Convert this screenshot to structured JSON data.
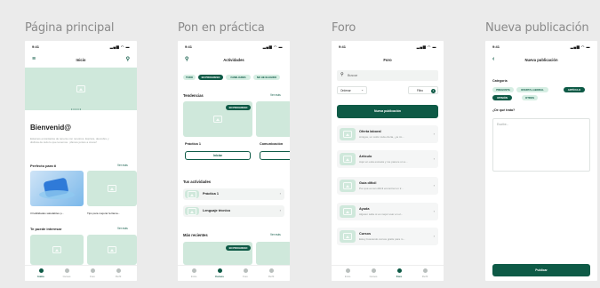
{
  "columns": {
    "home": "Página principal",
    "practice": "Pon en práctica",
    "forum": "Foro",
    "newpost": "Nueva publicación"
  },
  "status": {
    "time": "9:41",
    "icons": "▂▄▆ ◠ ▬"
  },
  "home": {
    "header": "Inicio",
    "welcome": "Bienvenid@",
    "welcome_text": "Estamos encantados de tenerte con nosotros. Explora, descubre y disfruta de todo lo que tenemos. ¡Vamos juntos a crecer!",
    "section1": "Perfecto para ti",
    "section2": "Te puede interesar",
    "see_more": "Ver más",
    "card1_caption": "3 habilidades saludables p...",
    "card2_caption": "Tips para mejorar la llama..."
  },
  "practice": {
    "header": "Actividades",
    "chips": [
      "TODO",
      "EN PROGRESO",
      "FAMILIARES",
      "NO HE ELEGIDO"
    ],
    "trends": "Tendencias",
    "see_more": "Ver más",
    "badge": "EN PROGRESO",
    "card1": "Práctica 1",
    "card2": "Comunicación",
    "start": "Iniciar",
    "your_acts": "Tus actividades",
    "act1": "Práctica 1",
    "act2": "Lenguaje técnico",
    "recent": "Más recientes"
  },
  "forum": {
    "header": "Foro",
    "search_placeholder": "Buscar",
    "sort": "Ordenar",
    "filter": "Filtro",
    "filter_count": "1",
    "new_post": "Nueva publicación",
    "items": [
      {
        "title": "Oferta laboral",
        "sub": "Amigos, un colón toda oferta, ¿te im..."
      },
      {
        "title": "Artículo",
        "sub": "Aquí en esta escuela y me parece un a..."
      },
      {
        "title": "Guía difícil",
        "sub": "Por qué es tan difícil encontrar un tr..."
      },
      {
        "title": "Ayuda",
        "sub": "Alguien sabe si es mejor usar en el..."
      },
      {
        "title": "Cursos",
        "sub": "Estoy buscando cursos gratis para m..."
      }
    ]
  },
  "newpost": {
    "header": "Nueva publicación",
    "category": "Categoría",
    "chips": [
      "PREGUNTA",
      "OFERTA LABORAL",
      "ARTÍCULO",
      "OPINIÓN",
      "OTROS"
    ],
    "question": "¿De qué trata?",
    "placeholder": "Escribe...",
    "publish": "Publicar"
  },
  "nav": {
    "home": "Inicio",
    "courses": "Cursos",
    "forum": "Foro",
    "profile": "Perfil"
  },
  "colors": {
    "accent": "#0e5a46",
    "mint": "#cfe8db",
    "bg": "#ebebeb"
  }
}
